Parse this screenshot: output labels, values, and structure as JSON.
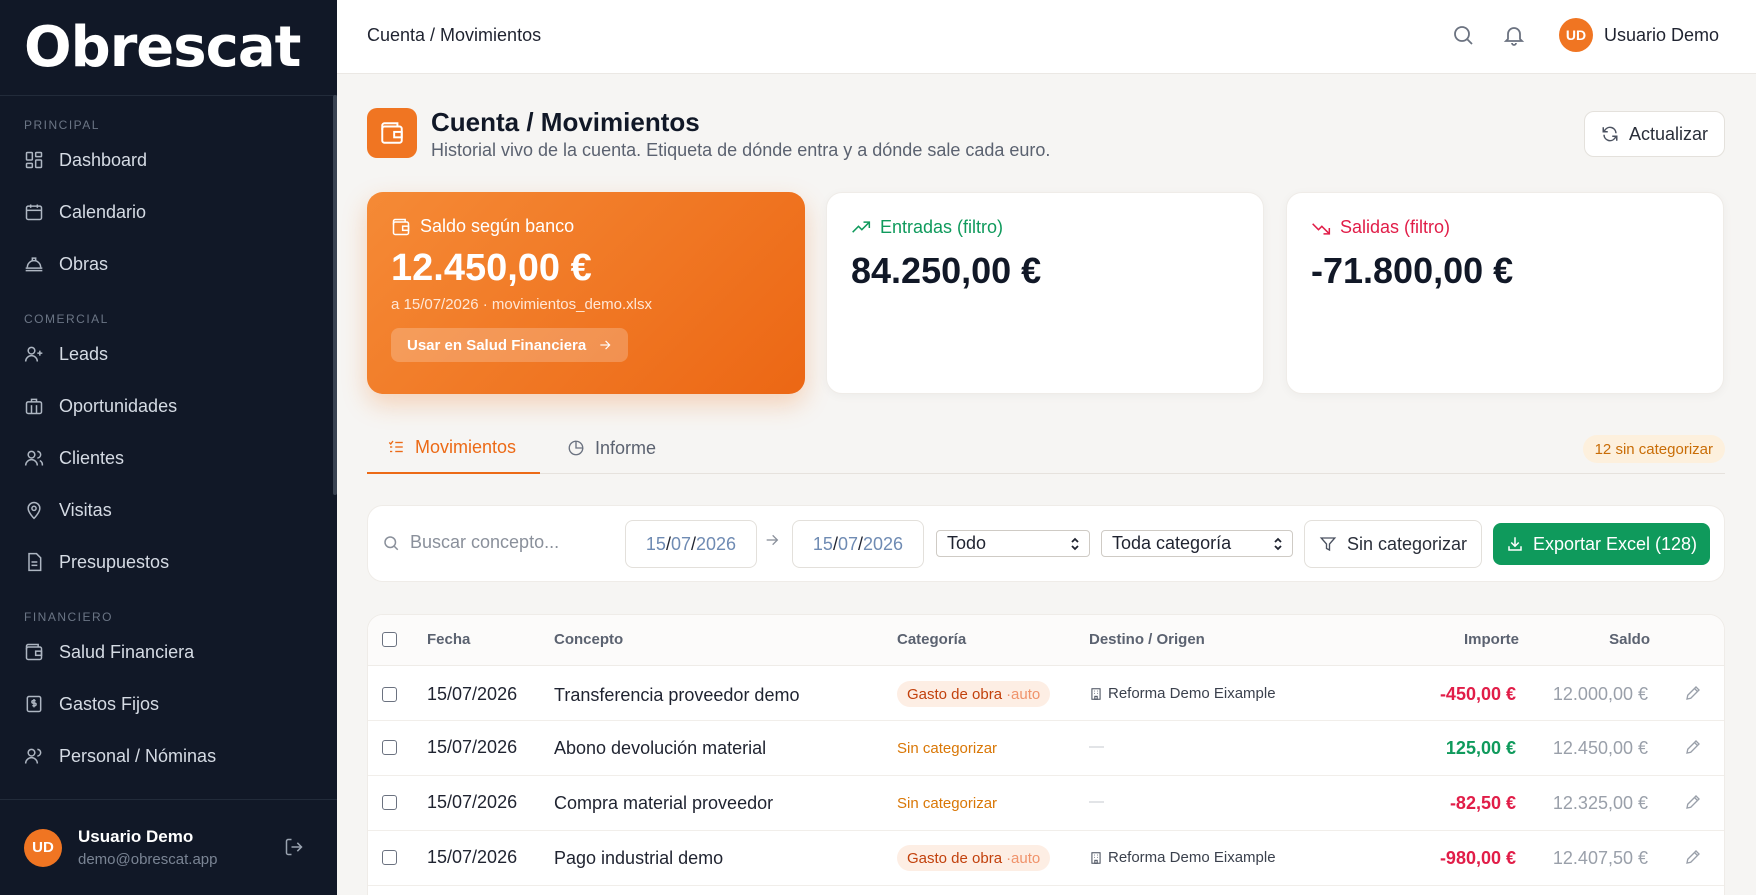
{
  "brand": "Obrescat",
  "sidebar": {
    "sections": [
      {
        "title": "PRINCIPAL",
        "items": [
          {
            "label": "Dashboard",
            "icon": "dashboard-icon"
          },
          {
            "label": "Calendario",
            "icon": "calendar-icon"
          },
          {
            "label": "Obras",
            "icon": "hardhat-icon"
          }
        ]
      },
      {
        "title": "COMERCIAL",
        "items": [
          {
            "label": "Leads",
            "icon": "user-plus-icon"
          },
          {
            "label": "Oportunidades",
            "icon": "briefcase-icon"
          },
          {
            "label": "Clientes",
            "icon": "users-icon"
          },
          {
            "label": "Visitas",
            "icon": "map-pin-icon"
          },
          {
            "label": "Presupuestos",
            "icon": "file-icon"
          }
        ]
      },
      {
        "title": "FINANCIERO",
        "items": [
          {
            "label": "Salud Financiera",
            "icon": "wallet-icon"
          },
          {
            "label": "Gastos Fijos",
            "icon": "receipt-icon"
          },
          {
            "label": "Personal / Nóminas",
            "icon": "users-icon"
          }
        ]
      }
    ],
    "user": {
      "initials": "UD",
      "name": "Usuario Demo",
      "email": "demo@obrescat.app"
    }
  },
  "topbar": {
    "breadcrumb": "Cuenta / Movimientos",
    "user_initials": "UD",
    "user_name": "Usuario Demo"
  },
  "page": {
    "title": "Cuenta / Movimientos",
    "subtitle": "Historial vivo de la cuenta. Etiqueta de dónde entra y a dónde sale cada euro.",
    "refresh_label": "Actualizar"
  },
  "cards": {
    "balance": {
      "label": "Saldo según banco",
      "value": "12.450,00 €",
      "meta": "a 15/07/2026 · movimientos_demo.xlsx",
      "button": "Usar en Salud Financiera"
    },
    "inflows": {
      "label": "Entradas (filtro)",
      "value": "84.250,00 €"
    },
    "outflows": {
      "label": "Salidas (filtro)",
      "value": "-71.800,00 €"
    }
  },
  "tabs": {
    "movements": "Movimientos",
    "report": "Informe",
    "uncategorized_badge": "12 sin categorizar"
  },
  "filters": {
    "search_placeholder": "Buscar concepto...",
    "date_from": {
      "d": "15",
      "m": "07",
      "y": "2026"
    },
    "date_to": {
      "d": "15",
      "m": "07",
      "y": "2026"
    },
    "type_select": "Todo",
    "category_select": "Toda categoría",
    "uncategorized_button": "Sin categorizar",
    "export_button": "Exportar Excel (128)"
  },
  "table": {
    "headers": {
      "date": "Fecha",
      "concept": "Concepto",
      "category": "Categoría",
      "destination": "Destino / Origen",
      "amount": "Importe",
      "balance": "Saldo"
    },
    "rows": [
      {
        "date": "15/07/2026",
        "concept": "Transferencia proveedor demo",
        "category": "Gasto de obra",
        "category_tag": "·auto",
        "destination": "Reforma Demo Eixample",
        "amount": "-450,00 €",
        "balance": "12.000,00 €"
      },
      {
        "date": "15/07/2026",
        "concept": "Abono devolución material",
        "category": "Sin categorizar",
        "category_tag": "",
        "destination": "—",
        "amount": "125,00 €",
        "balance": "12.450,00 €"
      },
      {
        "date": "15/07/2026",
        "concept": "Compra material proveedor",
        "category": "Sin categorizar",
        "category_tag": "",
        "destination": "—",
        "amount": "-82,50 €",
        "balance": "12.325,00 €"
      },
      {
        "date": "15/07/2026",
        "concept": "Pago industrial demo",
        "category": "Gasto de obra",
        "category_tag": "·auto",
        "destination": "Reforma Demo Eixample",
        "amount": "-980,00 €",
        "balance": "12.407,50 €"
      }
    ]
  },
  "colors": {
    "accent": "#f07522",
    "sidebar_bg": "#111827",
    "positive": "#0f9a5c",
    "negative": "#e11d48"
  }
}
